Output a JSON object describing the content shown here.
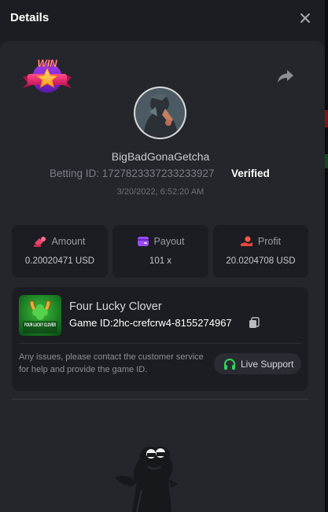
{
  "header": {
    "title": "Details"
  },
  "icons": {
    "close": "close-icon",
    "share": "share-icon",
    "win": "win-badge-icon",
    "amount": "coins-icon",
    "payout": "wallet-icon",
    "profit": "profit-icon",
    "copy": "copy-icon",
    "support": "headset-icon"
  },
  "badge": {
    "text": "WIN"
  },
  "player": {
    "username": "BigBadGonaGetcha",
    "betting_id_label": "Betting ID:",
    "betting_id": "1727823337233233927",
    "verified": "Verified",
    "datetime": "3/20/2022, 6:52:20 AM"
  },
  "stats": {
    "amount_label": "Amount",
    "amount_value": "0.20020471 USD",
    "payout_label": "Payout",
    "payout_value": "101 x",
    "profit_label": "Profit",
    "profit_value": "20.0204708 USD"
  },
  "game": {
    "name": "Four Lucky Clover",
    "id_label": "Game ID:",
    "id_value": "2hc-crefcrw4-8155274967",
    "thumb_text": "FOUR LUCKY CLOVER"
  },
  "support": {
    "notice": "Any issues, please contact the customer service for help and provide the game ID.",
    "button_label": "Live Support"
  },
  "colors": {
    "background": "#1c1d22",
    "card": "#25262c",
    "tile": "#1c1d22",
    "amount_icon": "#e8456a",
    "payout_icon": "#9b4cf2",
    "profit_icon": "#e0473e",
    "support_icon": "#2fd35c"
  }
}
